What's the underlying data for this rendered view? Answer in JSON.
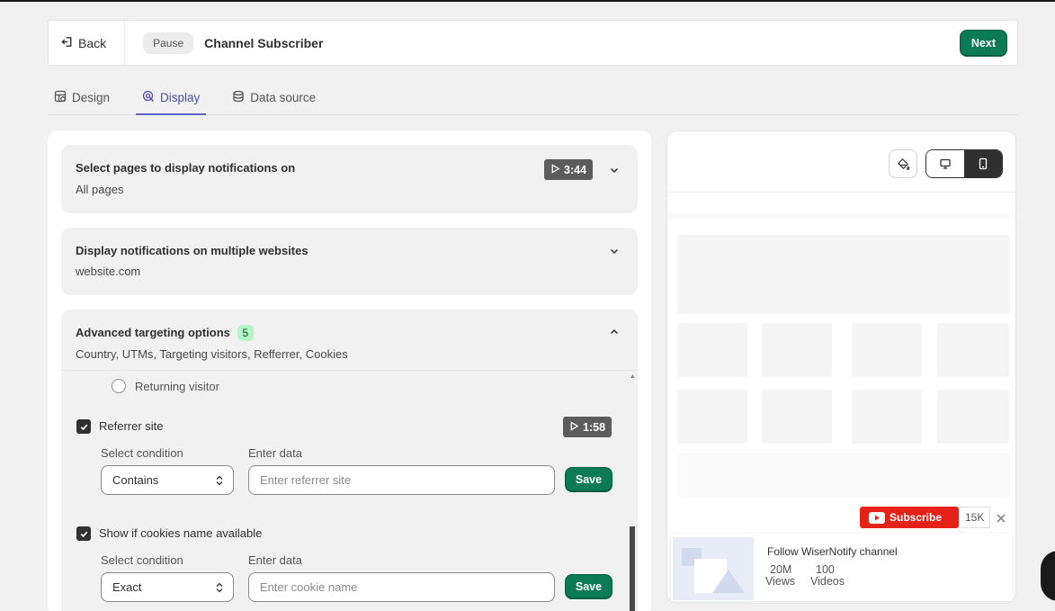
{
  "header": {
    "back_label": "Back",
    "pause_label": "Pause",
    "title": "Channel Subscriber",
    "next_label": "Next"
  },
  "tabs": [
    {
      "label": "Design",
      "icon": "design-icon",
      "active": false
    },
    {
      "label": "Display",
      "icon": "display-icon",
      "active": true
    },
    {
      "label": "Data source",
      "icon": "database-icon",
      "active": false
    }
  ],
  "sections": {
    "pages": {
      "title": "Select pages to display notifications on",
      "subtitle": "All pages",
      "video_time": "3:44"
    },
    "websites": {
      "title": "Display notifications on multiple websites",
      "subtitle": "website.com"
    },
    "advanced": {
      "title": "Advanced targeting options",
      "count": "5",
      "subtitle": "Country, UTMs, Targeting visitors, Refferrer, Cookies",
      "returning_visitor_label": "Returning visitor",
      "referrer": {
        "label": "Referrer site",
        "checked": true,
        "video_time": "1:58",
        "condition_label": "Select condition",
        "data_label": "Enter data",
        "condition_value": "Contains",
        "placeholder": "Enter referrer site",
        "save_label": "Save"
      },
      "cookies": {
        "label": "Show if cookies name available",
        "checked": true,
        "condition_label": "Select condition",
        "data_label": "Enter data",
        "condition_value": "Exact",
        "placeholder": "Enter cookie name",
        "save_label": "Save"
      }
    }
  },
  "preview": {
    "active_device": "mobile",
    "subscribe_label": "Subscribe",
    "subscriber_count": "15K",
    "notification_title": "Follow WiserNotify channel",
    "stats": [
      {
        "value": "20M",
        "label": "Views"
      },
      {
        "value": "100",
        "label": "Videos"
      }
    ]
  },
  "colors": {
    "primary": "#0b7a55",
    "tab_active": "#5b5fc7",
    "youtube_red": "#e62117",
    "badge_green": "#b4f5c6"
  }
}
